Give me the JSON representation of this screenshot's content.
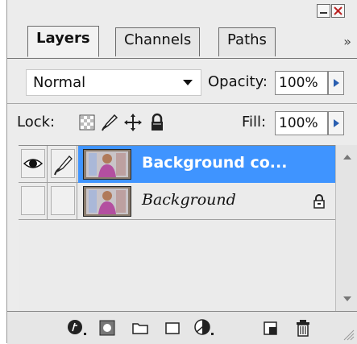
{
  "tabs": [
    {
      "label": "Layers"
    },
    {
      "label": "Channels"
    },
    {
      "label": "Paths"
    }
  ],
  "panel_menu_icon": "double-chevron-right-icon",
  "blend_mode": {
    "value": "Normal"
  },
  "opacity": {
    "label": "Opacity:",
    "value": "100%"
  },
  "lock": {
    "label": "Lock:",
    "icons": [
      "lock-transparent-icon",
      "lock-image-icon",
      "lock-position-icon",
      "lock-all-icon"
    ]
  },
  "fill": {
    "label": "Fill:",
    "value": "100%"
  },
  "layers": [
    {
      "name": "Background co...",
      "selected": true,
      "visible": true
    },
    {
      "name": "Background",
      "selected": false,
      "visible": false,
      "locked": true
    }
  ],
  "bottom_icons": [
    "layer-style-icon",
    "layer-mask-icon",
    "new-group-icon",
    "adjustment-layer-icon",
    "new-layer-icon",
    "trash-icon"
  ],
  "colors": {
    "selected": "#3f94ff",
    "panel": "#ececec"
  }
}
